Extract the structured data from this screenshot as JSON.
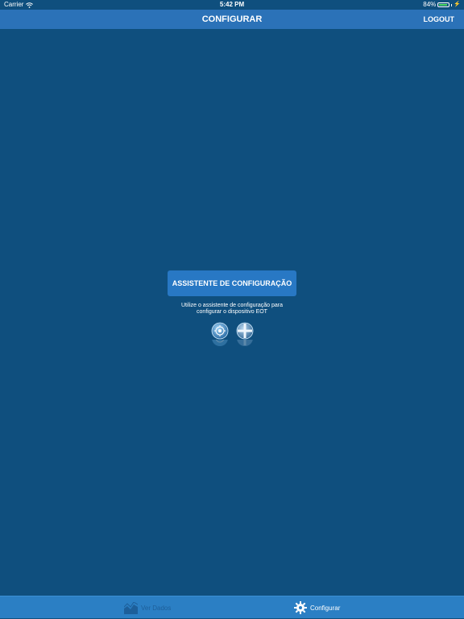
{
  "status_bar": {
    "carrier": "Carrier",
    "time": "5:42 PM",
    "battery_percent": "84%",
    "battery_level": 0.84,
    "icons": [
      "wifi-icon",
      "battery-icon",
      "charging-bolt-icon"
    ]
  },
  "nav_bar": {
    "title": "CONFIGURAR",
    "logout_label": "LOGOUT"
  },
  "main": {
    "wizard_button_label": "ASSISTENTE DE CONFIGURAÇÃO",
    "helper_line_1": "Utilize o assistente de configuração para",
    "helper_line_2": "configurar o dispositivo EOT",
    "device_icons": [
      "gauge-device-icon",
      "cross-device-icon"
    ]
  },
  "tab_bar": {
    "items": [
      {
        "label": "Ver Dados",
        "icon": "chart-icon",
        "active": false
      },
      {
        "label": "Configurar",
        "icon": "gear-icon",
        "active": true
      }
    ]
  },
  "colors": {
    "background": "#0f4f7e",
    "nav_bar": "#2b72b8",
    "button": "#2878c4",
    "tab_bar": "#2b7fc4",
    "tab_inactive": "#1d5f9a",
    "battery_green": "#4cd964"
  }
}
